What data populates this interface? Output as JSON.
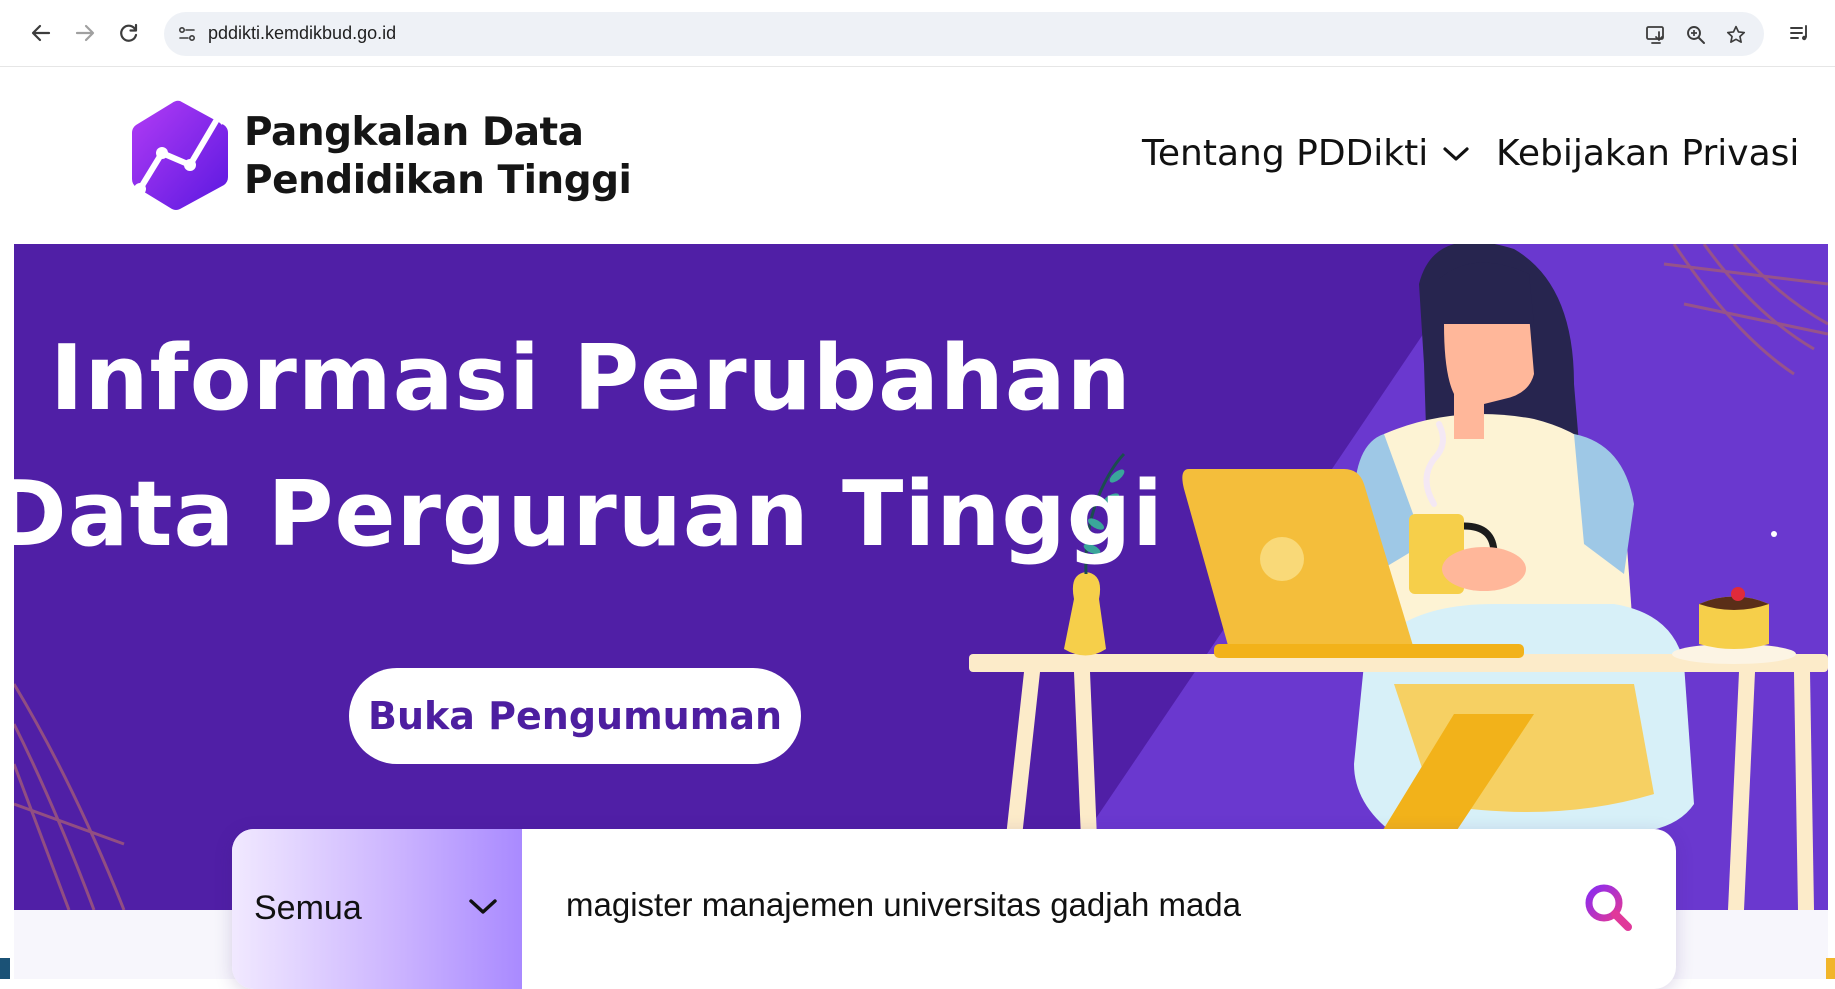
{
  "browser": {
    "url": "pddikti.kemdikbud.go.id",
    "back_icon": "arrow-left-icon",
    "forward_icon": "arrow-right-icon",
    "reload_icon": "reload-icon",
    "site_info_icon": "tune-icon",
    "install_icon": "install-app-icon",
    "zoom_icon": "zoom-icon",
    "bookmark_icon": "star-icon",
    "reading_list_icon": "reading-list-icon"
  },
  "header": {
    "logo_line1": "Pangkalan Data",
    "logo_line2": "Pendidikan Tinggi",
    "nav": {
      "about": "Tentang PDDikti",
      "privacy": "Kebijakan Privasi"
    }
  },
  "hero": {
    "line1": "Informasi Perubahan",
    "line2": "Data Perguruan Tinggi",
    "button": "Buka Pengumuman"
  },
  "search": {
    "filter_selected": "Semua",
    "query": "magister manajemen universitas gadjah mada"
  },
  "colors": {
    "hero_bg": "#501fa6",
    "brand_purple": "#7b2ff7",
    "search_icon_pink": "#e0389a",
    "text_dark": "#111111"
  }
}
